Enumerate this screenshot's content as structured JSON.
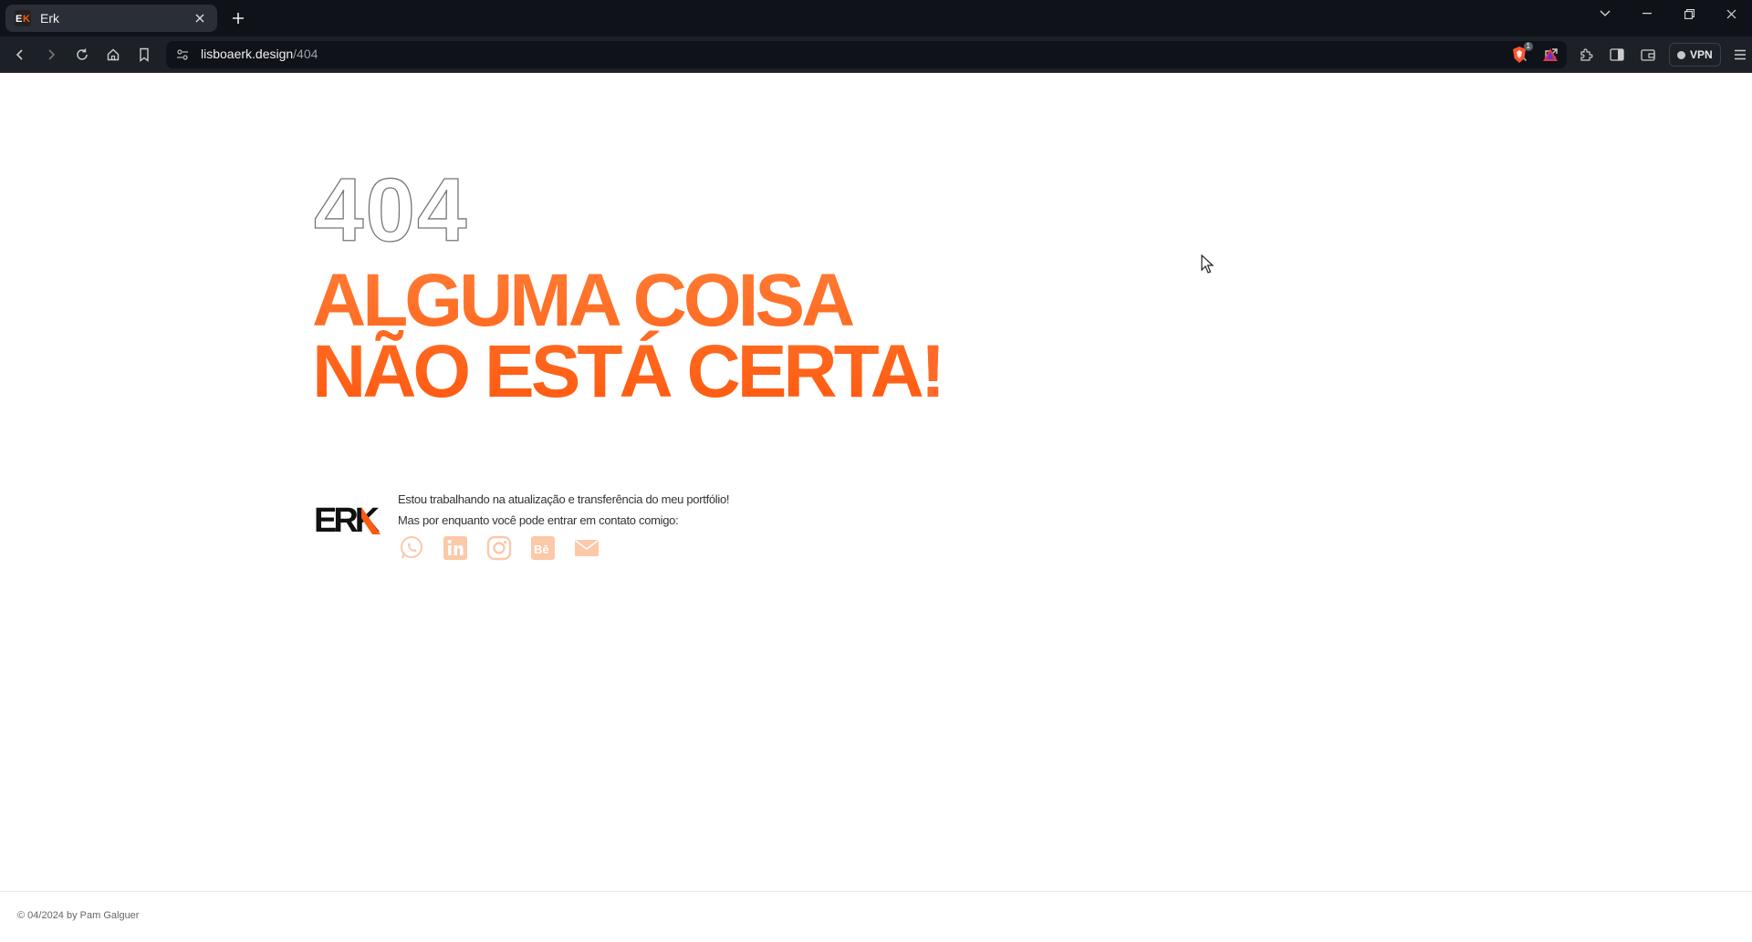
{
  "browser": {
    "tab_title": "Erk",
    "url_host": "lisboaerk.design",
    "url_path": "/404",
    "vpn_label": "VPN",
    "shield_badge": "1"
  },
  "page": {
    "code": "404",
    "headline_line1": "ALGUMA COISA",
    "headline_line2": "NÃO ESTÁ CERTA",
    "headline_excl": "!",
    "logo_text": "ERK",
    "contact_line1": "Estou trabalhando na atualização e transferência do meu portfólio!",
    "contact_line2": "Mas por enquanto você pode entrar em contato comigo:",
    "socials": [
      "whatsapp-icon",
      "linkedin-icon",
      "instagram-icon",
      "behance-icon",
      "email-icon"
    ],
    "accent_color": "#ff5a10",
    "social_color": "#fbc9a8"
  },
  "footer": {
    "text": "© 04/2024 by Pam Galguer"
  }
}
